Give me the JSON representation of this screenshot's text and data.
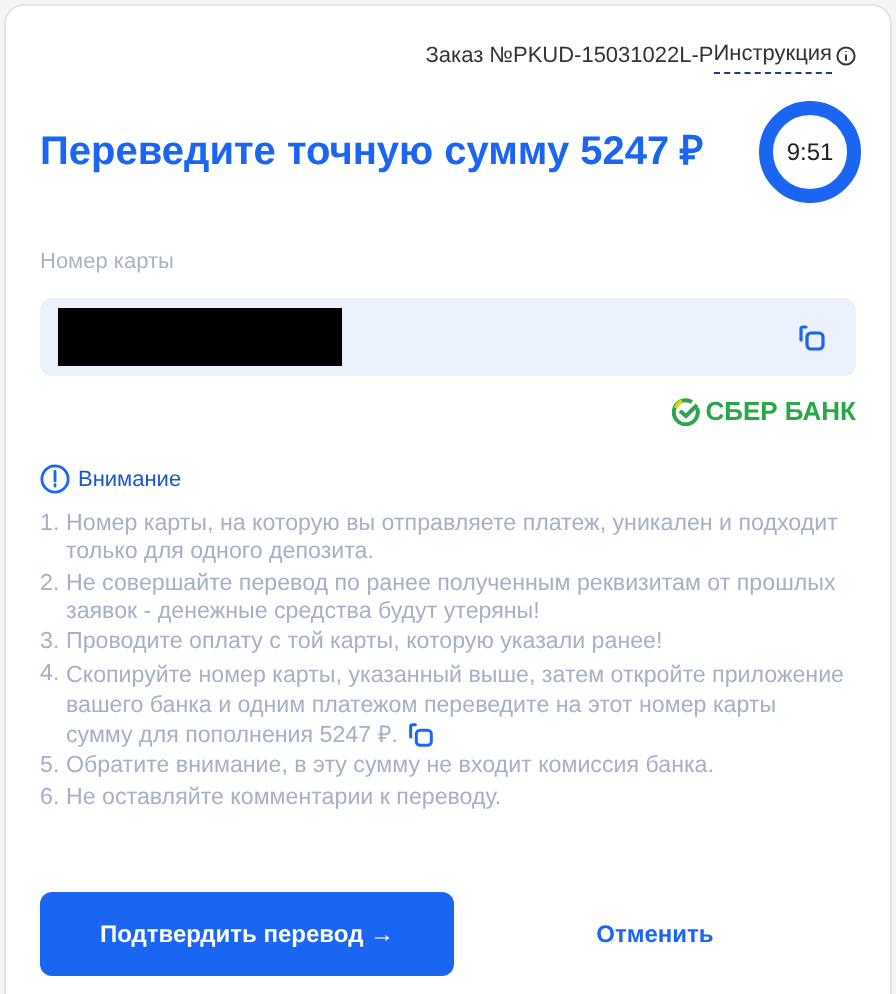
{
  "order": {
    "text": "Заказ №PKUD-15031022L-Р",
    "instructions_link": "Инструкция"
  },
  "title": "Переведите точную сумму 5247 ₽",
  "timer": {
    "text": "9:51"
  },
  "card_field": {
    "label": "Номер карты"
  },
  "bank_logo": "СБЕР БАНК",
  "warning": {
    "title": "Внимание",
    "items": [
      {
        "number": "1.",
        "text": "Номер карты, на которую вы отправляете платеж, уникален и подходит только для одного депозита.",
        "copy_icon": false
      },
      {
        "number": "2.",
        "text": "Не совершайте перевод по ранее полученным реквизитам от прошлых заявок - денежные средства будут утеряны!",
        "copy_icon": false
      },
      {
        "number": "3.",
        "text": "Проводите оплату с той карты, которую указали ранее!",
        "copy_icon": false
      },
      {
        "number": "4.",
        "text": "Скопируйте номер карты, указанный выше, затем откройте приложение вашего банка и одним платежом переведите на этот номер карты сумму для пополнения 5247 ₽.",
        "copy_icon": true
      },
      {
        "number": "5.",
        "text": "Обратите внимание, в эту сумму не входит комиссия банка.",
        "copy_icon": false
      },
      {
        "number": "6.",
        "text": "Не оставляйте комментарии к переводу.",
        "copy_icon": false
      }
    ]
  },
  "buttons": {
    "confirm": "Подтвердить перевод →",
    "cancel": "Отменить"
  }
}
